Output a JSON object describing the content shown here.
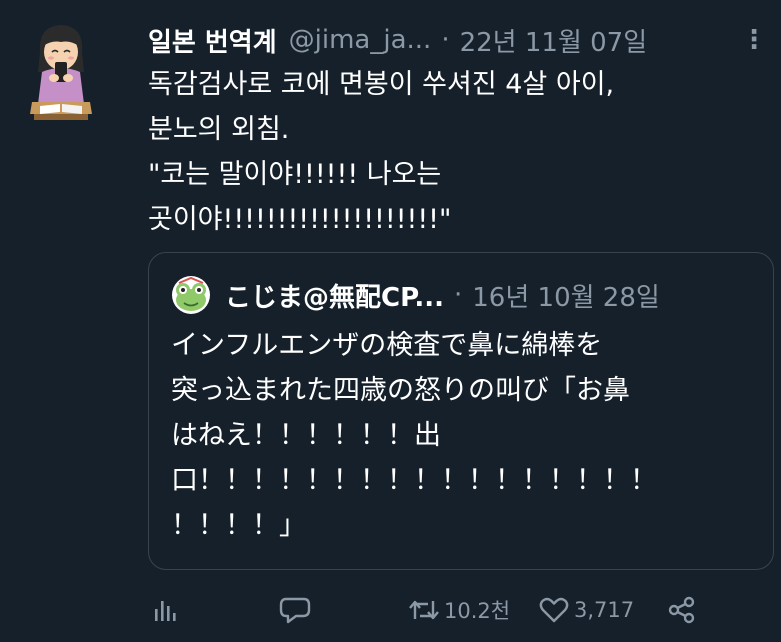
{
  "tweet": {
    "display_name": "일본 번역계",
    "handle": "@jima_ja...",
    "separator": "·",
    "date": "22년 11월 07일",
    "more_label": "⋮",
    "text": "독감검사로 코에 면봉이 쑤셔진 4살 아이,\n분노의 외침.\n\"코는 말이야!!!!!! 나오는\n곳이야!!!!!!!!!!!!!!!!!!!!\"",
    "avatar_icon": "girl-with-phone-avatar"
  },
  "quote": {
    "display_name": "こじま@無配CP...",
    "separator": "·",
    "date": "16년 10월 28일",
    "text": "インフルエンザの検査で鼻に綿棒を\n突っ込まれた四歳の怒りの叫び「お鼻\nはねえ！！！！！！出\n口！！！！！！！！！！！！！！！！！\n！！！！」",
    "avatar_icon": "frog-character-avatar"
  },
  "actions": {
    "views_icon": "bar-chart-icon",
    "reply_icon": "speech-bubble-icon",
    "retweet_icon": "retweet-icon",
    "retweet_count": "10.2천",
    "like_icon": "heart-icon",
    "like_count": "3,717",
    "share_icon": "share-icon"
  },
  "colors": {
    "background": "#15202b",
    "text": "#ffffff",
    "secondary": "#8b98a5",
    "border": "#38444d"
  }
}
